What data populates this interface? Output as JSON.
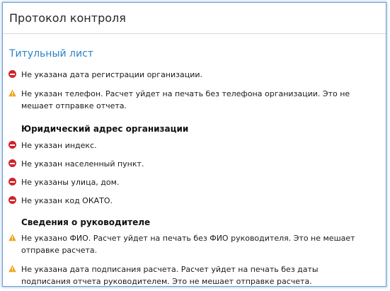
{
  "header": {
    "title": "Протокол контроля"
  },
  "section": {
    "title": "Титульный лист"
  },
  "messages_top": [
    {
      "type": "error",
      "icon": "error-circle-icon",
      "text": "Не указана дата регистрации организации."
    },
    {
      "type": "warning",
      "icon": "warning-triangle-icon",
      "text": "Не указан телефон. Расчет уйдет на печать без телефона организации. Это не мешает отправке отчета."
    }
  ],
  "address": {
    "title": "Юридический адрес организации",
    "messages": [
      {
        "type": "error",
        "icon": "error-circle-icon",
        "text": "Не указан индекс."
      },
      {
        "type": "error",
        "icon": "error-circle-icon",
        "text": "Не указан населенный пункт."
      },
      {
        "type": "error",
        "icon": "error-circle-icon",
        "text": "Не указаны улица, дом."
      },
      {
        "type": "error",
        "icon": "error-circle-icon",
        "text": "Не указан код ОКАТО."
      }
    ]
  },
  "director": {
    "title": "Сведения о руководителе",
    "messages": [
      {
        "type": "warning",
        "icon": "warning-triangle-icon",
        "text": "Не указано ФИО. Расчет уйдет на печать без ФИО руководителя. Это не мешает отправке расчета."
      },
      {
        "type": "warning",
        "icon": "warning-triangle-icon",
        "text": "Не указана дата подписания расчета. Расчет уйдет на печать без даты подписания отчета руководителем. Это не мешает отправке расчета."
      }
    ]
  },
  "colors": {
    "accent": "#2a82c6",
    "error": "#d2232a",
    "warning": "#f0a31e",
    "border": "#6f9fd2"
  }
}
